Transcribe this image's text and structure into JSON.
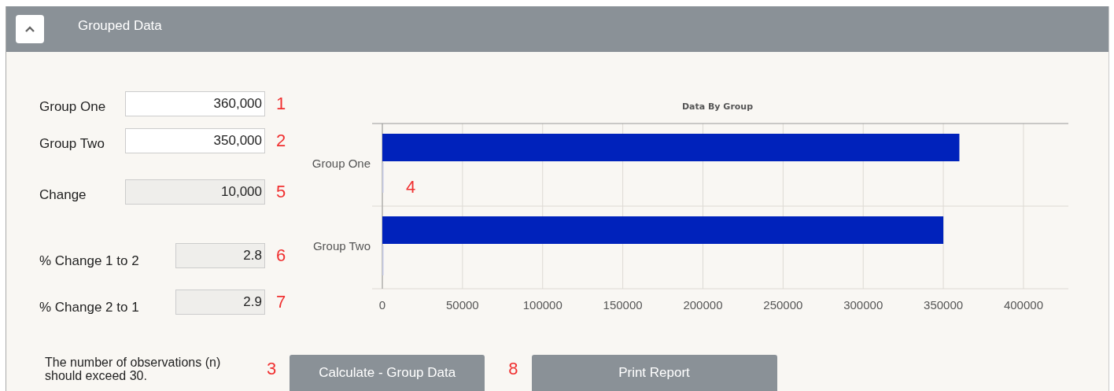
{
  "panel": {
    "title": "Grouped Data",
    "expanded": true
  },
  "fields": [
    {
      "label": "Group One",
      "value": "360,000",
      "kind": "input",
      "marker": "1"
    },
    {
      "label": "Group Two",
      "value": "350,000",
      "kind": "input",
      "marker": "2"
    },
    {
      "label": "Change",
      "value": "10,000",
      "kind": "output",
      "marker": "5"
    },
    {
      "label": "% Change 1 to 2",
      "value": "2.8",
      "kind": "percent",
      "marker": "6"
    },
    {
      "label": "% Change 2 to 1",
      "value": "2.9",
      "kind": "percent",
      "marker": "7"
    }
  ],
  "chart": {
    "chart_data": {
      "type": "bar",
      "orientation": "horizontal",
      "title": "Data By Group",
      "categories": [
        "Group One",
        "Group Two"
      ],
      "grid": true,
      "series": [
        {
          "color": "#0022bb",
          "values": [
            360000,
            350000
          ]
        },
        {
          "color": "#c5cae6",
          "values": [
            0,
            0
          ]
        }
      ],
      "xlim": [
        0,
        428000
      ],
      "xticks": [
        0,
        50000,
        100000,
        150000,
        200000,
        250000,
        300000,
        350000,
        400000
      ],
      "annotations": [
        {
          "text": "4"
        }
      ]
    }
  },
  "note": "The number of observations (n) should exceed 30.",
  "buttons": [
    {
      "marker": "3",
      "label": "Calculate - Group Data"
    },
    {
      "marker": "8",
      "label": "Print Report"
    }
  ]
}
